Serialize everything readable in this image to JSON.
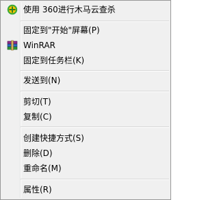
{
  "menu": {
    "items": [
      {
        "label": "使用 360进行木马云查杀",
        "icon": "360-shield-icon"
      },
      {
        "label": "固定到\"开始\"屏幕(P)"
      },
      {
        "label": "WinRAR",
        "icon": "winrar-icon"
      },
      {
        "label": "固定到任务栏(K)"
      },
      {
        "label": "发送到(N)"
      },
      {
        "label": "剪切(T)"
      },
      {
        "label": "复制(C)"
      },
      {
        "label": "创建快捷方式(S)"
      },
      {
        "label": "删除(D)"
      },
      {
        "label": "重命名(M)"
      },
      {
        "label": "属性(R)"
      }
    ]
  },
  "colors": {
    "menu_bg": "#f0f0f0",
    "border": "#979797",
    "separator": "#d7d7d7",
    "icon_360_green": "#3aa935",
    "icon_360_yellow": "#f5c400"
  }
}
